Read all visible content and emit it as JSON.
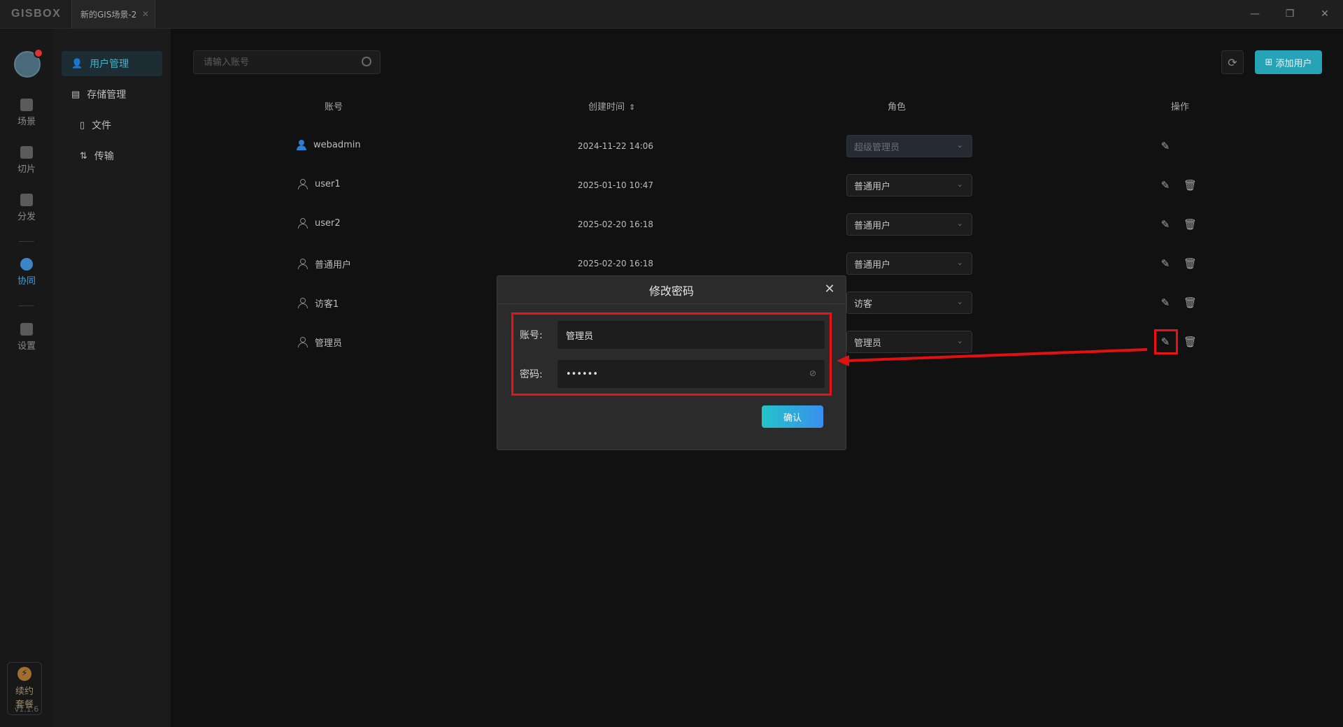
{
  "app": {
    "logo": "GISBOX",
    "tab_title": "新的GIS场景-2",
    "tab_close": "✕",
    "version": "v1.1.6"
  },
  "window_controls": {
    "minimize": "—",
    "restore": "❐",
    "close": "✕"
  },
  "sidebar": {
    "items": [
      {
        "label": "场景",
        "icon": "scene-icon"
      },
      {
        "label": "切片",
        "icon": "tile-icon"
      },
      {
        "label": "分发",
        "icon": "distribute-icon"
      },
      {
        "label": "协同",
        "icon": "collaborate-icon",
        "active": true
      },
      {
        "label": "设置",
        "icon": "settings-icon"
      }
    ],
    "renew": {
      "line1": "续约",
      "line2": "套餐",
      "icon": "⚡"
    }
  },
  "subnav": {
    "items": [
      {
        "label": "用户管理",
        "icon": "user-icon",
        "active": true
      },
      {
        "label": "存储管理",
        "icon": "storage-icon"
      },
      {
        "label": "文件",
        "icon": "file-icon"
      },
      {
        "label": "传输",
        "icon": "transfer-icon"
      }
    ]
  },
  "toolbar": {
    "search_placeholder": "请输入账号",
    "refresh_icon": "⟳",
    "add_label": "添加用户",
    "add_icon": "⊞"
  },
  "table": {
    "headers": {
      "account": "账号",
      "created": "创建时间",
      "sort_icon": "⇕",
      "role": "角色",
      "actions": "操作"
    },
    "rows": [
      {
        "account": "webadmin",
        "created": "2024-11-22 14:06",
        "role": "超级管理员",
        "disabled": true,
        "deletable": false
      },
      {
        "account": "user1",
        "created": "2025-01-10 10:47",
        "role": "普通用户",
        "deletable": true
      },
      {
        "account": "user2",
        "created": "2025-02-20 16:18",
        "role": "普通用户",
        "deletable": true
      },
      {
        "account": "普通用户",
        "created": "2025-02-20 16:18",
        "role": "普通用户",
        "deletable": true
      },
      {
        "account": "访客1",
        "created": "",
        "role": "访客",
        "deletable": true
      },
      {
        "account": "管理员",
        "created": "",
        "role": "管理员",
        "deletable": true
      }
    ],
    "edit_icon": "✎",
    "delete_icon": "🗑",
    "chevron": "⌄"
  },
  "modal": {
    "title": "修改密码",
    "close": "✕",
    "account_label": "账号:",
    "account_value": "管理员",
    "password_label": "密码:",
    "password_value": "••••••",
    "eye_icon": "⊘",
    "confirm": "确认"
  },
  "colors": {
    "accent": "#27a3b8",
    "annotation": "#e11111",
    "active_nav": "#3aa1d8"
  }
}
